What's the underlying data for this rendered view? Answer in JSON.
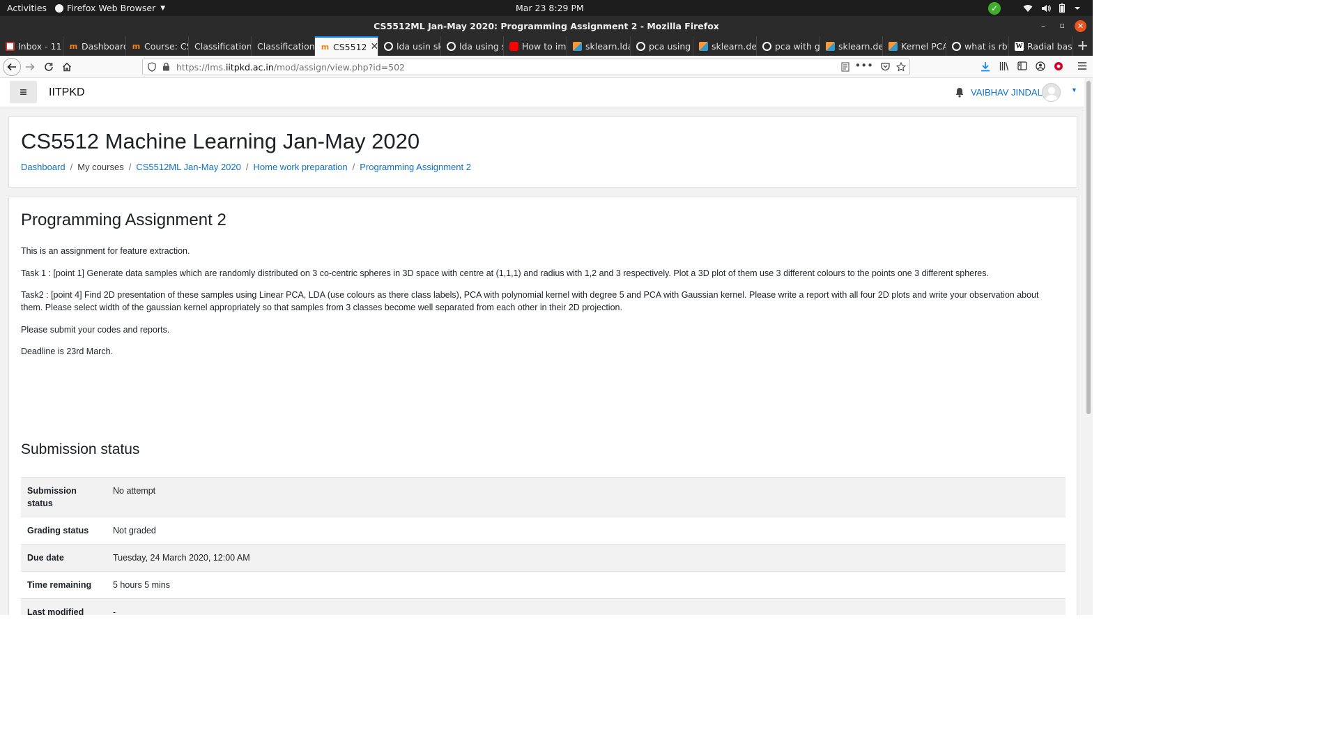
{
  "system_bar": {
    "activities": "Activities",
    "app_name": "Firefox Web Browser",
    "clock": "Mar 23  8:29 PM"
  },
  "window": {
    "title": "CS5512ML Jan-May 2020: Programming Assignment 2 - Mozilla Firefox"
  },
  "tabs": [
    {
      "label": "Inbox - 11",
      "icon": "gmail-icon"
    },
    {
      "label": "Dashboard",
      "icon": "moodle-icon"
    },
    {
      "label": "Course: CS",
      "icon": "moodle-icon"
    },
    {
      "label": "Classification",
      "icon": "none"
    },
    {
      "label": "Classification",
      "icon": "none"
    },
    {
      "label": "CS5512",
      "icon": "moodle-icon",
      "active": true
    },
    {
      "label": "lda usin sk",
      "icon": "google-icon"
    },
    {
      "label": "lda using s",
      "icon": "google-icon"
    },
    {
      "label": "How to im",
      "icon": "youtube-icon"
    },
    {
      "label": "sklearn.lda",
      "icon": "sklearn-icon"
    },
    {
      "label": "pca using",
      "icon": "google-icon"
    },
    {
      "label": "sklearn.de",
      "icon": "sklearn-icon"
    },
    {
      "label": "pca with g",
      "icon": "google-icon"
    },
    {
      "label": "sklearn.de",
      "icon": "sklearn-icon"
    },
    {
      "label": "Kernel PCA",
      "icon": "sklearn-icon"
    },
    {
      "label": "what is rbf",
      "icon": "google-icon"
    },
    {
      "label": "Radial bas",
      "icon": "wikipedia-icon"
    }
  ],
  "navbar": {
    "url_prefix": "https://lms.",
    "url_domain": "iitpkd.ac.in",
    "url_path": "/mod/assign/view.php?id=502"
  },
  "moodle_header": {
    "brand": "IITPKD",
    "user_name": "VAIBHAV JINDAL"
  },
  "course": {
    "title": "CS5512 Machine Learning Jan-May 2020",
    "breadcrumbs": [
      {
        "label": "Dashboard",
        "link": true
      },
      {
        "label": "My courses",
        "link": false
      },
      {
        "label": "CS5512ML Jan-May 2020",
        "link": true
      },
      {
        "label": "Home work preparation",
        "link": true
      },
      {
        "label": "Programming Assignment 2",
        "link": true
      }
    ],
    "separator": "/"
  },
  "assignment": {
    "title": "Programming Assignment 2",
    "paragraphs": [
      "This is an assignment for feature extraction.",
      "Task 1 : [point 1] Generate data samples which are randomly distributed on 3 co-centric spheres in 3D space with centre at (1,1,1) and radius with 1,2 and 3 respectively.  Plot a 3D plot of them use 3 different colours  to the points one 3 different spheres.",
      "Task2 : [point 4] Find 2D presentation of these samples using Linear PCA, LDA (use colours as there class labels), PCA with polynomial kernel with degree 5 and PCA with Gaussian kernel. Please write a report with all four 2D plots and write your observation  about them. Please select width of the gaussian kernel appropriately so that samples from 3 classes become well separated from each other in their 2D projection.",
      "Please submit your codes and reports.",
      "Deadline is 23rd March."
    ]
  },
  "submission": {
    "title": "Submission status",
    "rows": [
      {
        "label": "Submission status",
        "value": "No attempt"
      },
      {
        "label": "Grading status",
        "value": "Not graded"
      },
      {
        "label": "Due date",
        "value": "Tuesday, 24 March 2020, 12:00 AM"
      },
      {
        "label": "Time remaining",
        "value": "5 hours 5 mins"
      },
      {
        "label": "Last modified",
        "value": "-"
      }
    ]
  }
}
